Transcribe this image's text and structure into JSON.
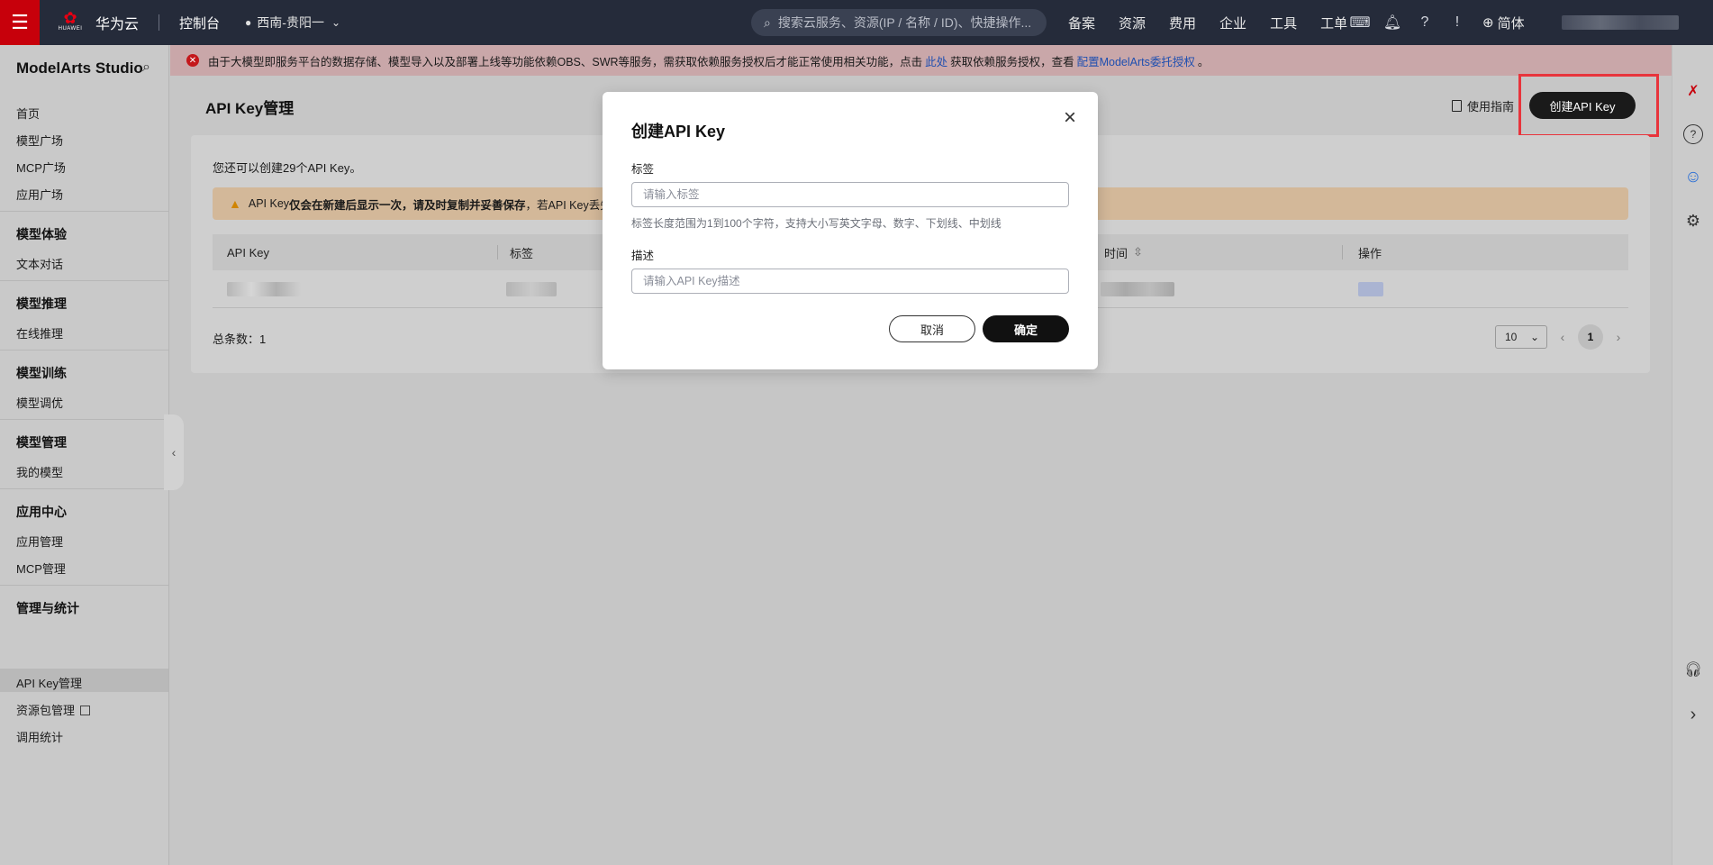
{
  "topbar": {
    "brand": "华为云",
    "logo_sub": "HUAWEI",
    "console": "控制台",
    "region": "西南-贵阳一",
    "search_placeholder": "搜索云服务、资源(IP / 名称 / ID)、快捷操作...",
    "nav": [
      "备案",
      "资源",
      "费用",
      "企业",
      "工具",
      "工单"
    ],
    "lang": "简体"
  },
  "sidebar": {
    "title": "ModelArts Studio",
    "items": {
      "home": "首页",
      "model_square": "模型广场",
      "mcp_square": "MCP广场",
      "app_square": "应用广场",
      "g_experience": "模型体验",
      "text_chat": "文本对话",
      "g_inference": "模型推理",
      "online_inference": "在线推理",
      "g_training": "模型训练",
      "model_tuning": "模型调优",
      "g_management": "模型管理",
      "my_models": "我的模型",
      "g_app_center": "应用中心",
      "app_management": "应用管理",
      "mcp_management": "MCP管理",
      "g_mgmt_stats": "管理与统计",
      "api_key_management": "API Key管理",
      "resource_package": "资源包管理",
      "call_stats": "调用统计"
    }
  },
  "banner": {
    "text_before": "由于大模型即服务平台的数据存储、模型导入以及部署上线等功能依赖OBS、SWR等服务，需获取依赖服务授权后才能正常使用相关功能，点击",
    "link1": "此处",
    "text_middle": "获取依赖服务授权，查看",
    "link2": "配置ModelArts委托授权",
    "text_after": "。"
  },
  "page": {
    "title": "API Key管理",
    "guide": "使用指南",
    "create_button": "创建API Key",
    "remaining": "您还可以创建29个API Key。",
    "warning_prefix": "API Key",
    "warning_bold": "仅会在新建后显示一次，请及时复制并妥善保存",
    "warning_suffix": "，若API Key丢失,"
  },
  "table": {
    "columns": [
      "API Key",
      "标签",
      "时间",
      "操作"
    ],
    "total": "总条数：1"
  },
  "pagination": {
    "page_size": "10",
    "current_page": "1"
  },
  "modal": {
    "title": "创建API Key",
    "tag_label": "标签",
    "tag_placeholder": "请输入标签",
    "tag_hint": "标签长度范围为1到100个字符，支持大小写英文字母、数字、下划线、中划线",
    "desc_label": "描述",
    "desc_placeholder": "请输入API Key描述",
    "cancel": "取消",
    "confirm": "确定"
  }
}
